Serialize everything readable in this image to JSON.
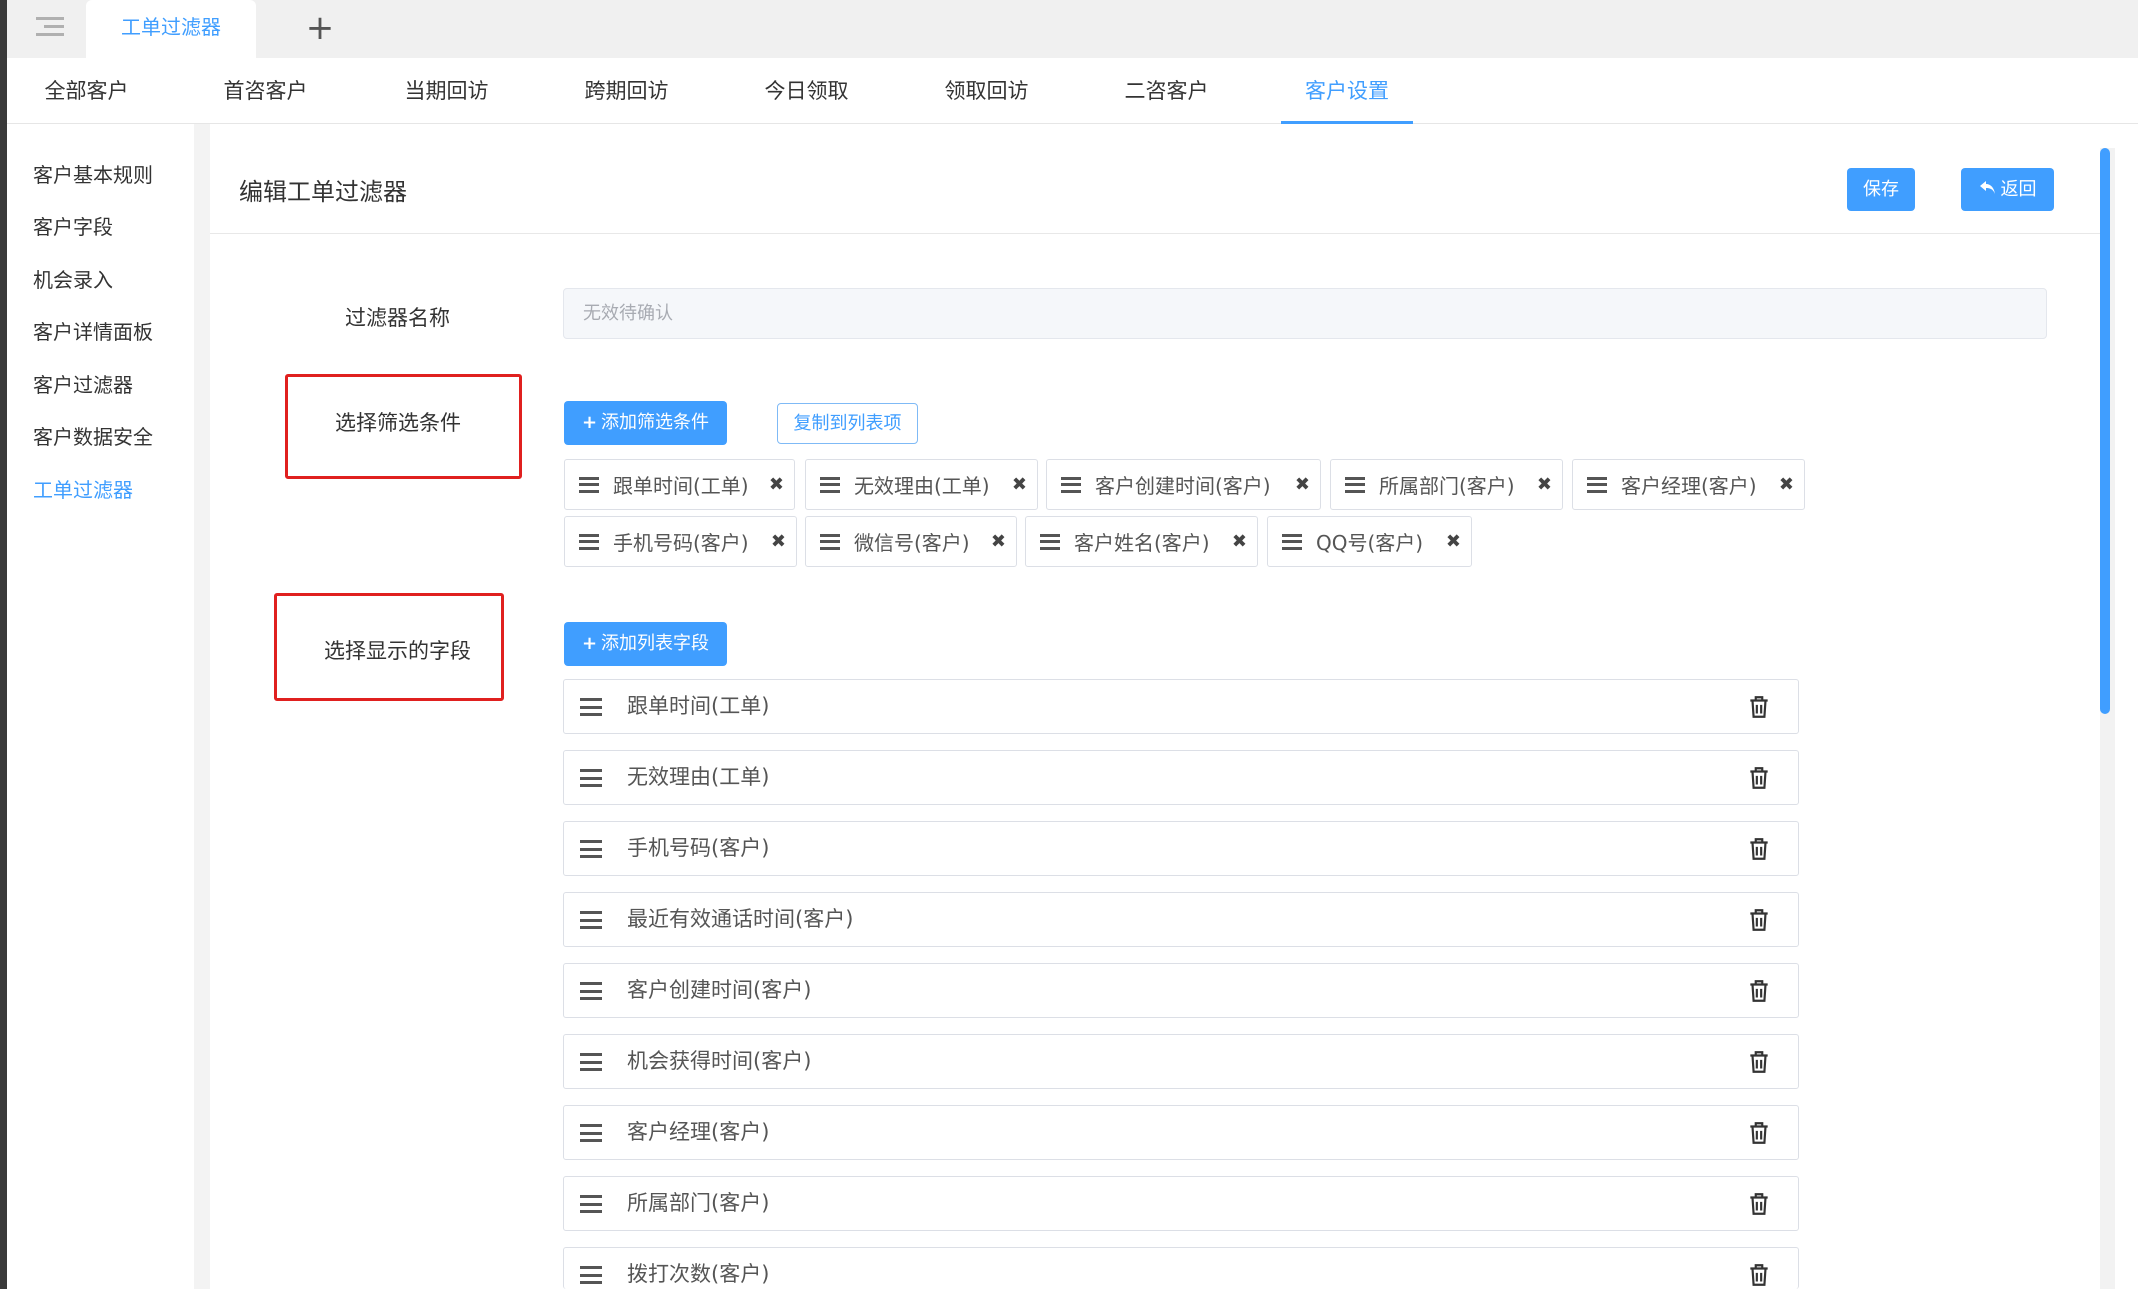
{
  "tabs": {
    "active_label": "工单过滤器",
    "add_symbol": "+"
  },
  "nav": {
    "items": [
      "全部客户",
      "首咨客户",
      "当期回访",
      "跨期回访",
      "今日领取",
      "领取回访",
      "二咨客户",
      "客户设置"
    ],
    "active": "客户设置"
  },
  "sidebar": {
    "items": [
      "客户基本规则",
      "客户字段",
      "机会录入",
      "客户详情面板",
      "客户过滤器",
      "客户数据安全",
      "工单过滤器"
    ],
    "active": "工单过滤器"
  },
  "page": {
    "title": "编辑工单过滤器",
    "save_label": "保存",
    "back_label": "返回",
    "back_icon": "undo-arrow-icon"
  },
  "form": {
    "name_label": "过滤器名称",
    "name_value": "无效待确认",
    "filter_label": "选择筛选条件",
    "add_filter_label": "添加筛选条件",
    "copy_label": "复制到列表项",
    "display_label": "选择显示的字段",
    "add_column_label": "添加列表字段"
  },
  "filter_chips": [
    "跟单时间(工单)",
    "无效理由(工单)",
    "客户创建时间(客户)",
    "所属部门(客户)",
    "客户经理(客户)",
    "手机号码(客户)",
    "微信号(客户)",
    "客户姓名(客户)",
    "QQ号(客户)"
  ],
  "display_fields": [
    "跟单时间(工单)",
    "无效理由(工单)",
    "手机号码(客户)",
    "最近有效通话时间(客户)",
    "客户创建时间(客户)",
    "机会获得时间(客户)",
    "客户经理(客户)",
    "所属部门(客户)",
    "拨打次数(客户)"
  ],
  "icons": {
    "close": "✖",
    "plus": "+"
  },
  "colors": {
    "accent": "#409eff",
    "highlight_box": "#e0201f"
  }
}
